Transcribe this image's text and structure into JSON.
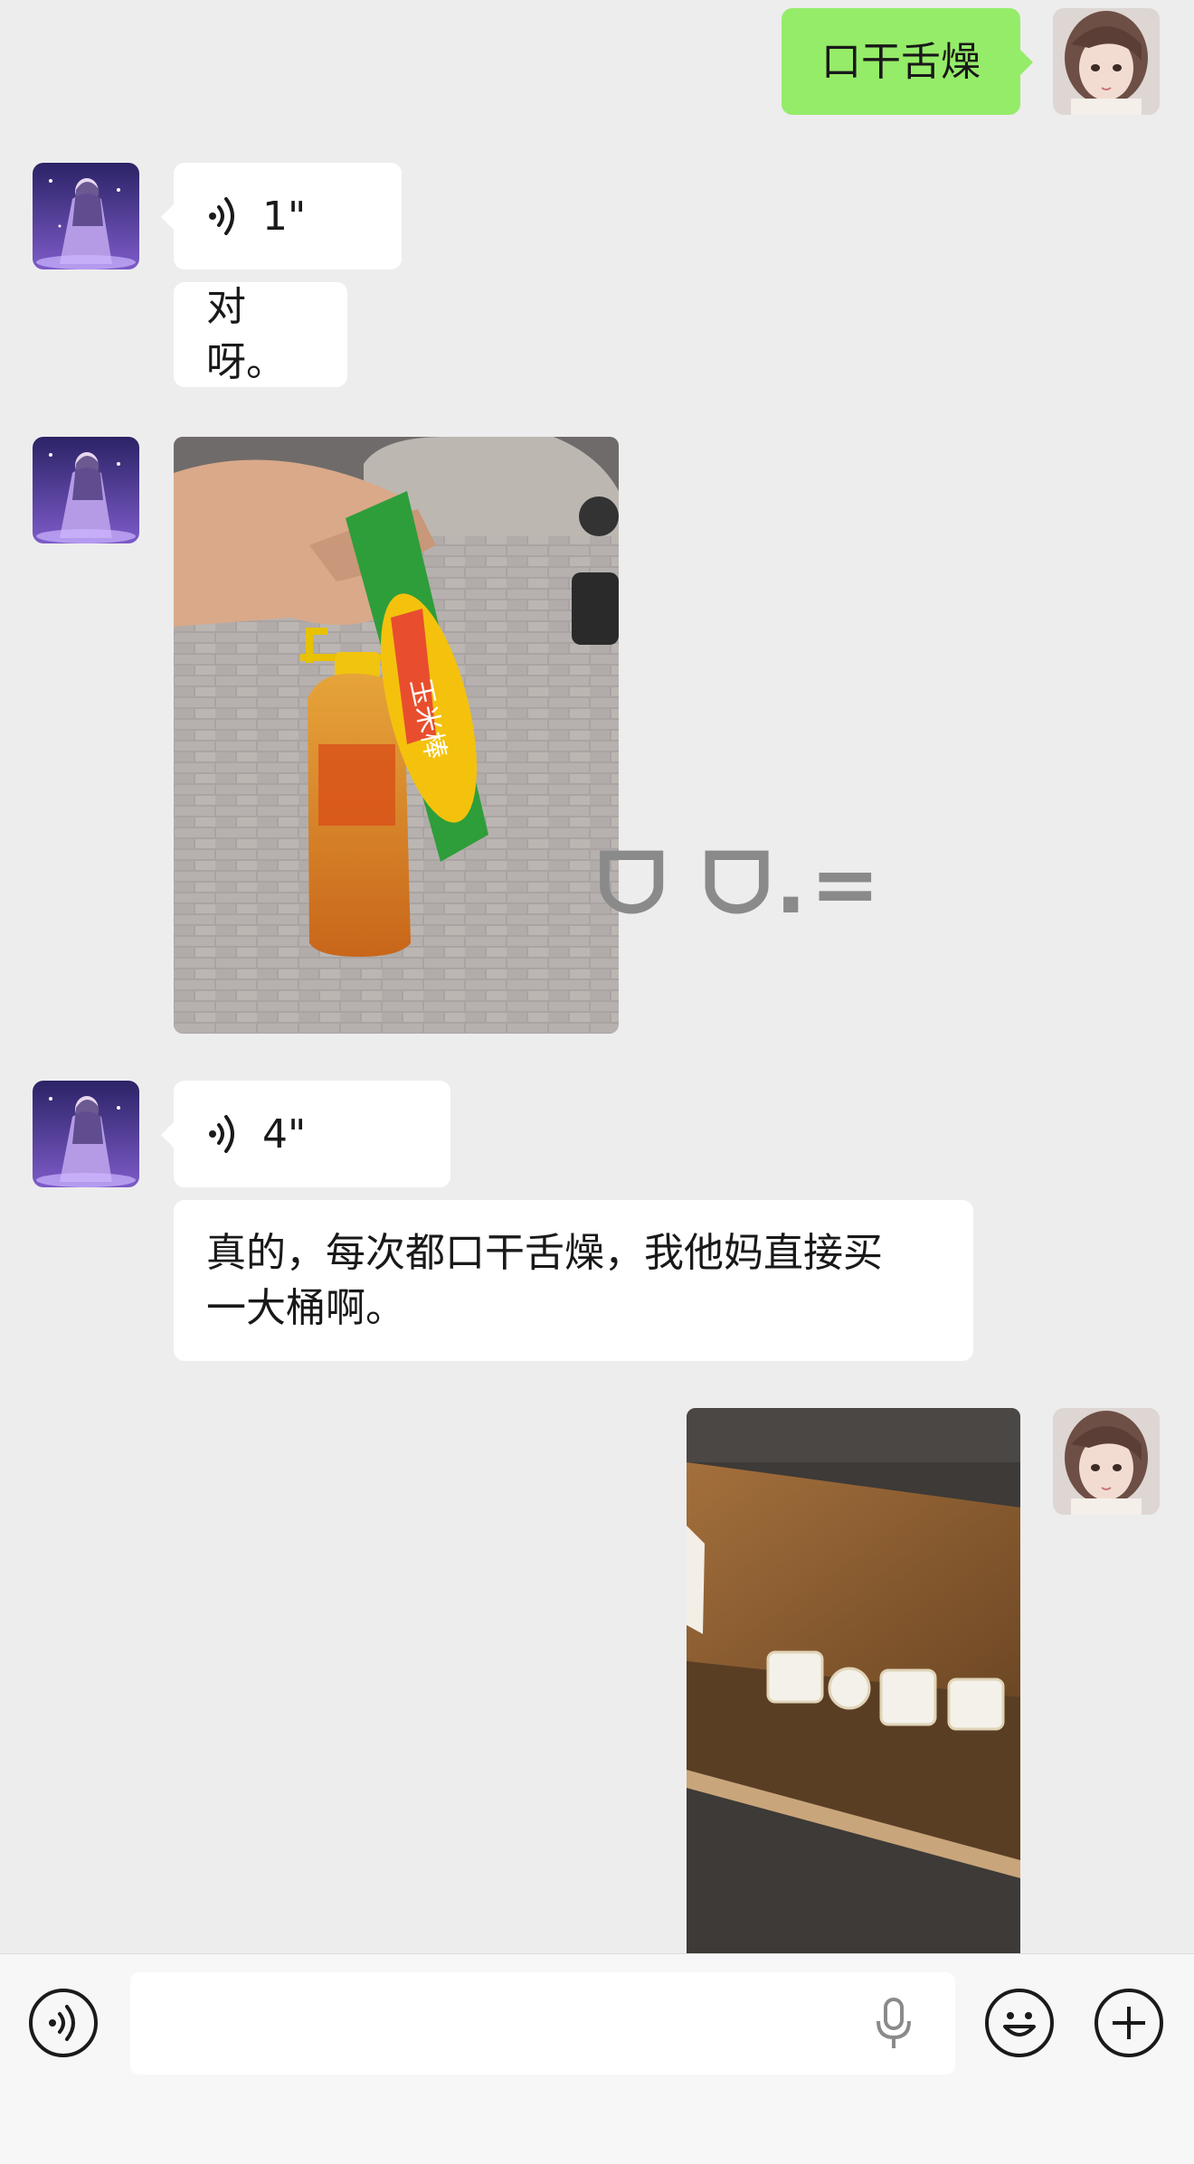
{
  "messages": {
    "m1": {
      "text": "口干舌燥"
    },
    "m2": {
      "duration": "1\""
    },
    "m3": {
      "text": "对呀。"
    },
    "m5": {
      "duration": "4\""
    },
    "m6": {
      "line1": "真的，每次都口干舌燥，我他妈直接买",
      "line2": "一大桶啊。"
    }
  },
  "photo1": {
    "overlay_text": "ᗜ ᗜ.=",
    "corn_pack_label": "玉米棒"
  },
  "input": {
    "value": "",
    "placeholder": ""
  },
  "icons": {
    "voice_toggle": "voice-mode-icon",
    "mic": "microphone-icon",
    "emoji": "emoji-icon",
    "plus": "plus-icon"
  },
  "colors": {
    "self_bubble": "#95ec69",
    "other_bubble": "#ffffff",
    "background": "#ededed"
  }
}
